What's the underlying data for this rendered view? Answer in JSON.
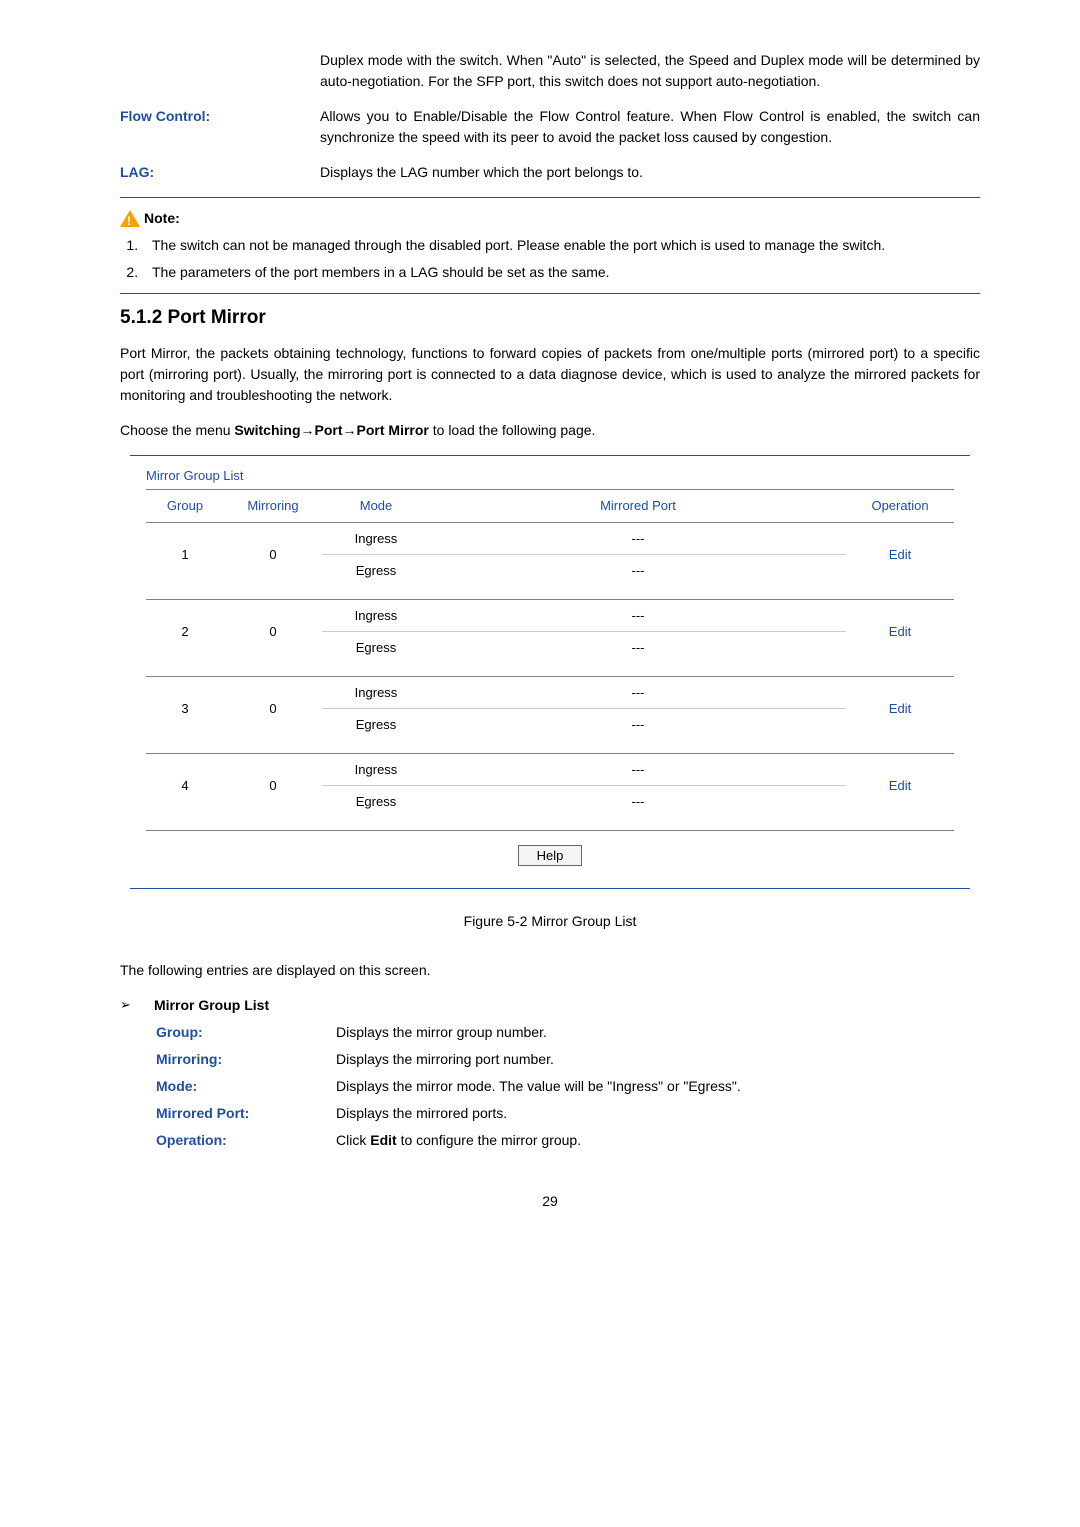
{
  "top_defs": [
    {
      "label": "",
      "text": "Duplex mode with the switch. When \"Auto\" is selected, the Speed and Duplex mode will be determined by auto-negotiation. For the SFP port, this switch does not support auto-negotiation."
    },
    {
      "label": "Flow Control:",
      "text": "Allows you to Enable/Disable the Flow Control feature. When Flow Control is enabled, the switch can synchronize the speed with its peer to avoid the packet loss caused by congestion."
    },
    {
      "label": "LAG:",
      "text": "Displays the LAG number which the port belongs to."
    }
  ],
  "note_label": "Note:",
  "notes": [
    "The switch can not be managed through the disabled port. Please enable the port which is used to manage the switch.",
    "The parameters of the port members in a LAG should be set as the same."
  ],
  "section_heading": "5.1.2 Port Mirror",
  "section_para": "Port Mirror, the packets obtaining technology, functions to forward copies of packets from one/multiple ports (mirrored port) to a specific port (mirroring port). Usually, the mirroring port is connected to a data diagnose device, which is used to analyze the mirrored packets for monitoring and troubleshooting the network.",
  "menu_sentence_prefix": "Choose the menu ",
  "menu_sentence_bold": "Switching→Port→Port Mirror",
  "menu_sentence_suffix": " to load the following page.",
  "table_title": "Mirror Group List",
  "headers": {
    "group": "Group",
    "mirroring": "Mirroring",
    "mode": "Mode",
    "mirrored": "Mirrored Port",
    "operation": "Operation"
  },
  "rows": [
    {
      "group": "1",
      "mirroring": "0",
      "mode1": "Ingress",
      "mirrored1": "---",
      "mode2": "Egress",
      "mirrored2": "---",
      "op": "Edit"
    },
    {
      "group": "2",
      "mirroring": "0",
      "mode1": "Ingress",
      "mirrored1": "---",
      "mode2": "Egress",
      "mirrored2": "---",
      "op": "Edit"
    },
    {
      "group": "3",
      "mirroring": "0",
      "mode1": "Ingress",
      "mirrored1": "---",
      "mode2": "Egress",
      "mirrored2": "---",
      "op": "Edit"
    },
    {
      "group": "4",
      "mirroring": "0",
      "mode1": "Ingress",
      "mirrored1": "---",
      "mode2": "Egress",
      "mirrored2": "---",
      "op": "Edit"
    }
  ],
  "help_label": "Help",
  "figure_caption": "Figure 5-2 Mirror Group List",
  "entries_sentence": "The following entries are displayed on this screen.",
  "bullet_heading": "Mirror Group List",
  "defs2": [
    {
      "label": "Group:",
      "text": "Displays the mirror group number."
    },
    {
      "label": "Mirroring:",
      "text": "Displays the mirroring port number."
    },
    {
      "label": "Mode:",
      "text": "Displays the mirror mode. The value will be \"Ingress\" or \"Egress\"."
    },
    {
      "label": "Mirrored Port:",
      "text": "Displays the mirrored ports."
    }
  ],
  "operation_label": "Operation:",
  "operation_prefix": "Click ",
  "operation_bold": "Edit",
  "operation_suffix": " to configure the mirror group.",
  "page_number": "29"
}
